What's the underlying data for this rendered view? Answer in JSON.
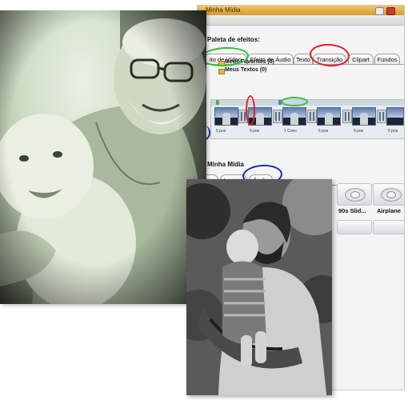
{
  "window": {
    "title": "Minha Mídia",
    "palette_title": "Paleta de efeitos:",
    "tabs": [
      {
        "label": "ito de Vídeo",
        "circled": true
      },
      {
        "label": "Efeito de Áudio",
        "circled": false
      },
      {
        "label": "Texto",
        "circled": false
      },
      {
        "label": "Transição",
        "circled": true
      },
      {
        "label": "Clipart",
        "circled": false
      },
      {
        "label": "Fundos",
        "circled": false
      }
    ],
    "favorites": [
      {
        "label": "Meus Favoritos (0)"
      },
      {
        "label": "Meus Textos (0)"
      }
    ],
    "timeline": {
      "clip_labels": [
        "5 pos",
        "5 pos",
        "1 Conc",
        "5 pos",
        "5 pos",
        "5 pos"
      ]
    },
    "media_panel": {
      "title": "Minha Mídia",
      "tabs": [
        {
          "label": "eos",
          "circled": false
        },
        {
          "label": "Imagen",
          "circled": false
        },
        {
          "label": "Áudio",
          "circled": true
        }
      ],
      "tiles": [
        {
          "label": "90s Slid...",
          "icon": "transition-preview-icon"
        },
        {
          "label": "Airplane",
          "icon": "transition-preview-icon"
        }
      ]
    }
  },
  "annotation_colors": {
    "green": "#2fbf3a",
    "red": "#e02020",
    "blue": "#1a2fa0"
  },
  "photos": [
    {
      "name": "grandfather-baby-photo",
      "tone": "green-tinted"
    },
    {
      "name": "father-baby-photo",
      "tone": "black-and-white"
    }
  ]
}
